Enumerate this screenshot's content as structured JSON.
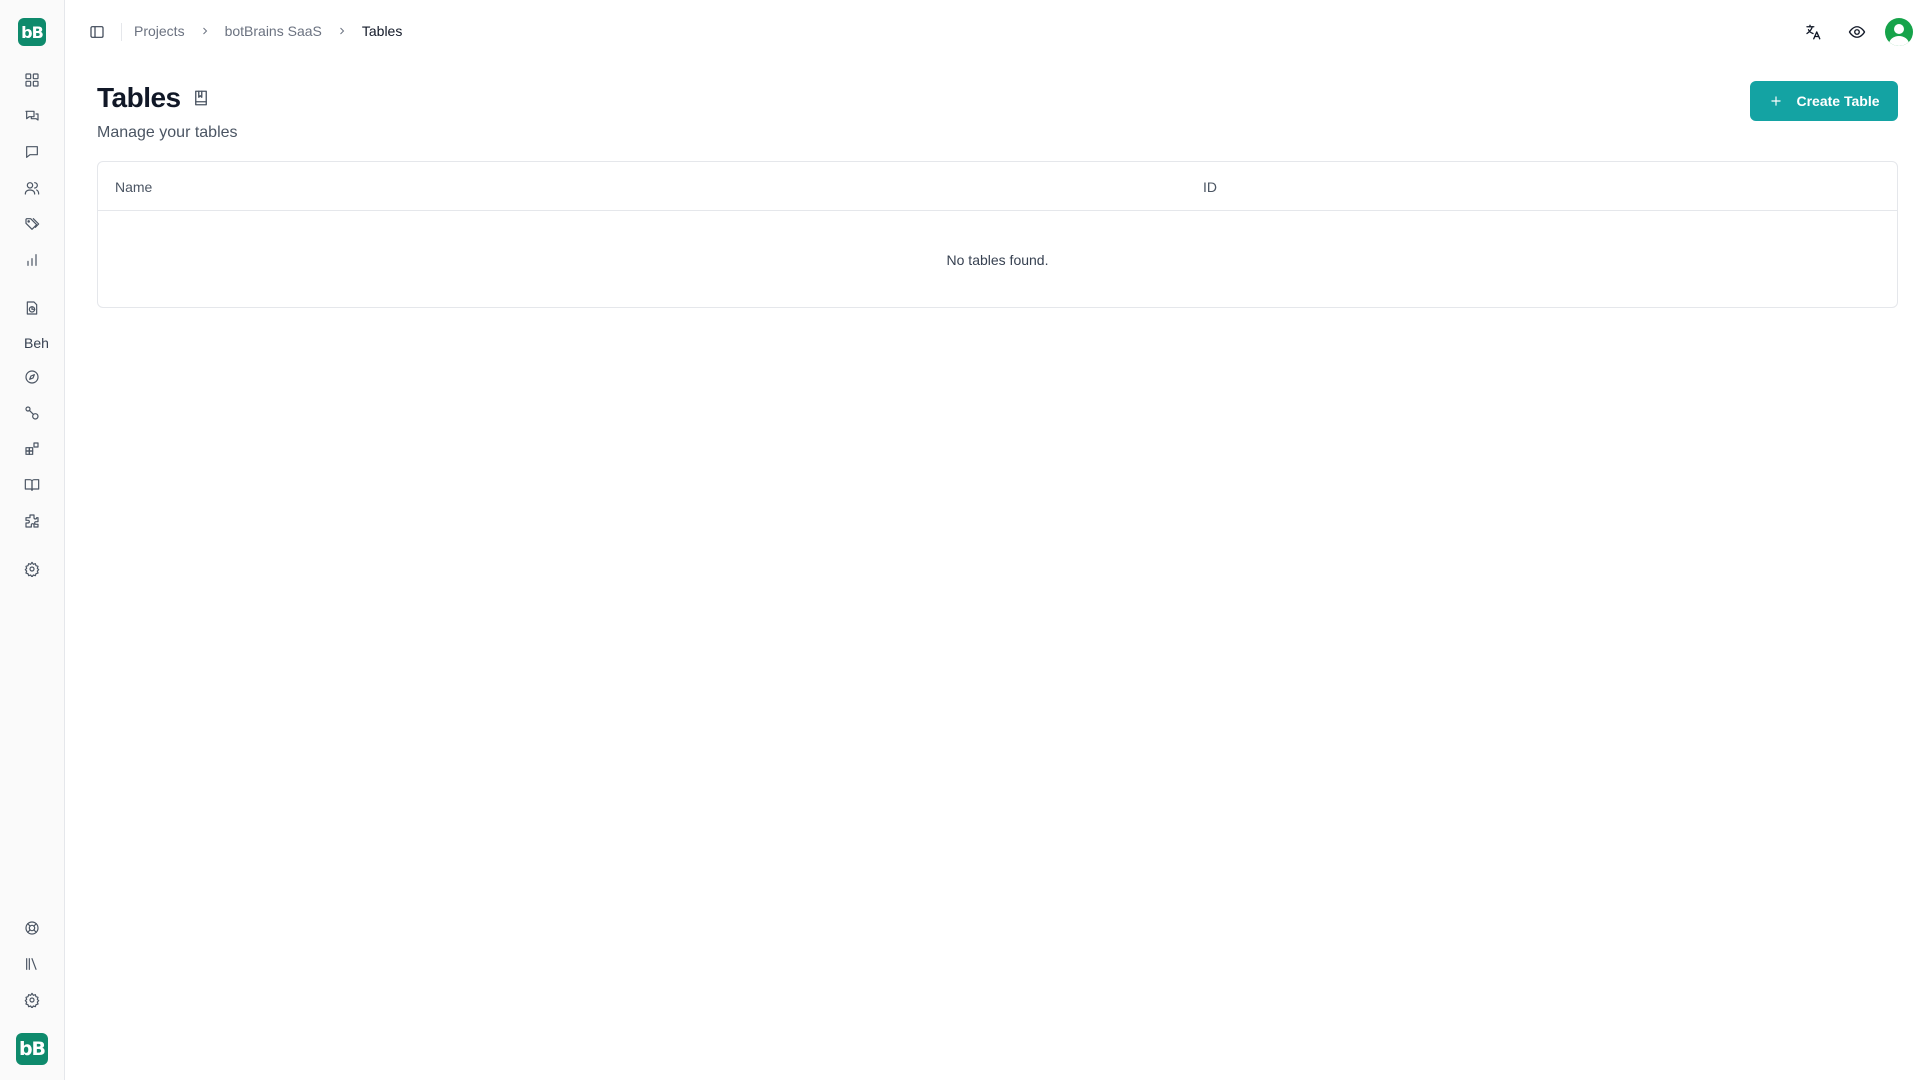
{
  "sidebar": {
    "logo_text": "bB",
    "section_label": "Beh",
    "icons": [
      "dashboard-icon",
      "conversations-icon",
      "chat-icon",
      "users-icon",
      "tags-icon",
      "analytics-icon",
      "reports-icon",
      "explore-icon",
      "workflows-icon",
      "integrations-icon",
      "knowledge-icon",
      "plugins-icon",
      "settings-icon",
      "help-icon",
      "library-icon",
      "preferences-icon"
    ]
  },
  "breadcrumb": {
    "items": [
      "Projects",
      "botBrains SaaS",
      "Tables"
    ]
  },
  "header": {
    "title": "Tables",
    "subtitle": "Manage your tables",
    "create_button": "Create Table"
  },
  "table": {
    "columns": [
      "Name",
      "ID"
    ],
    "empty_message": "No tables found."
  },
  "colors": {
    "brand": "#0e8a6c",
    "primary_button": "#14a3a3",
    "avatar": "#16a34a"
  }
}
